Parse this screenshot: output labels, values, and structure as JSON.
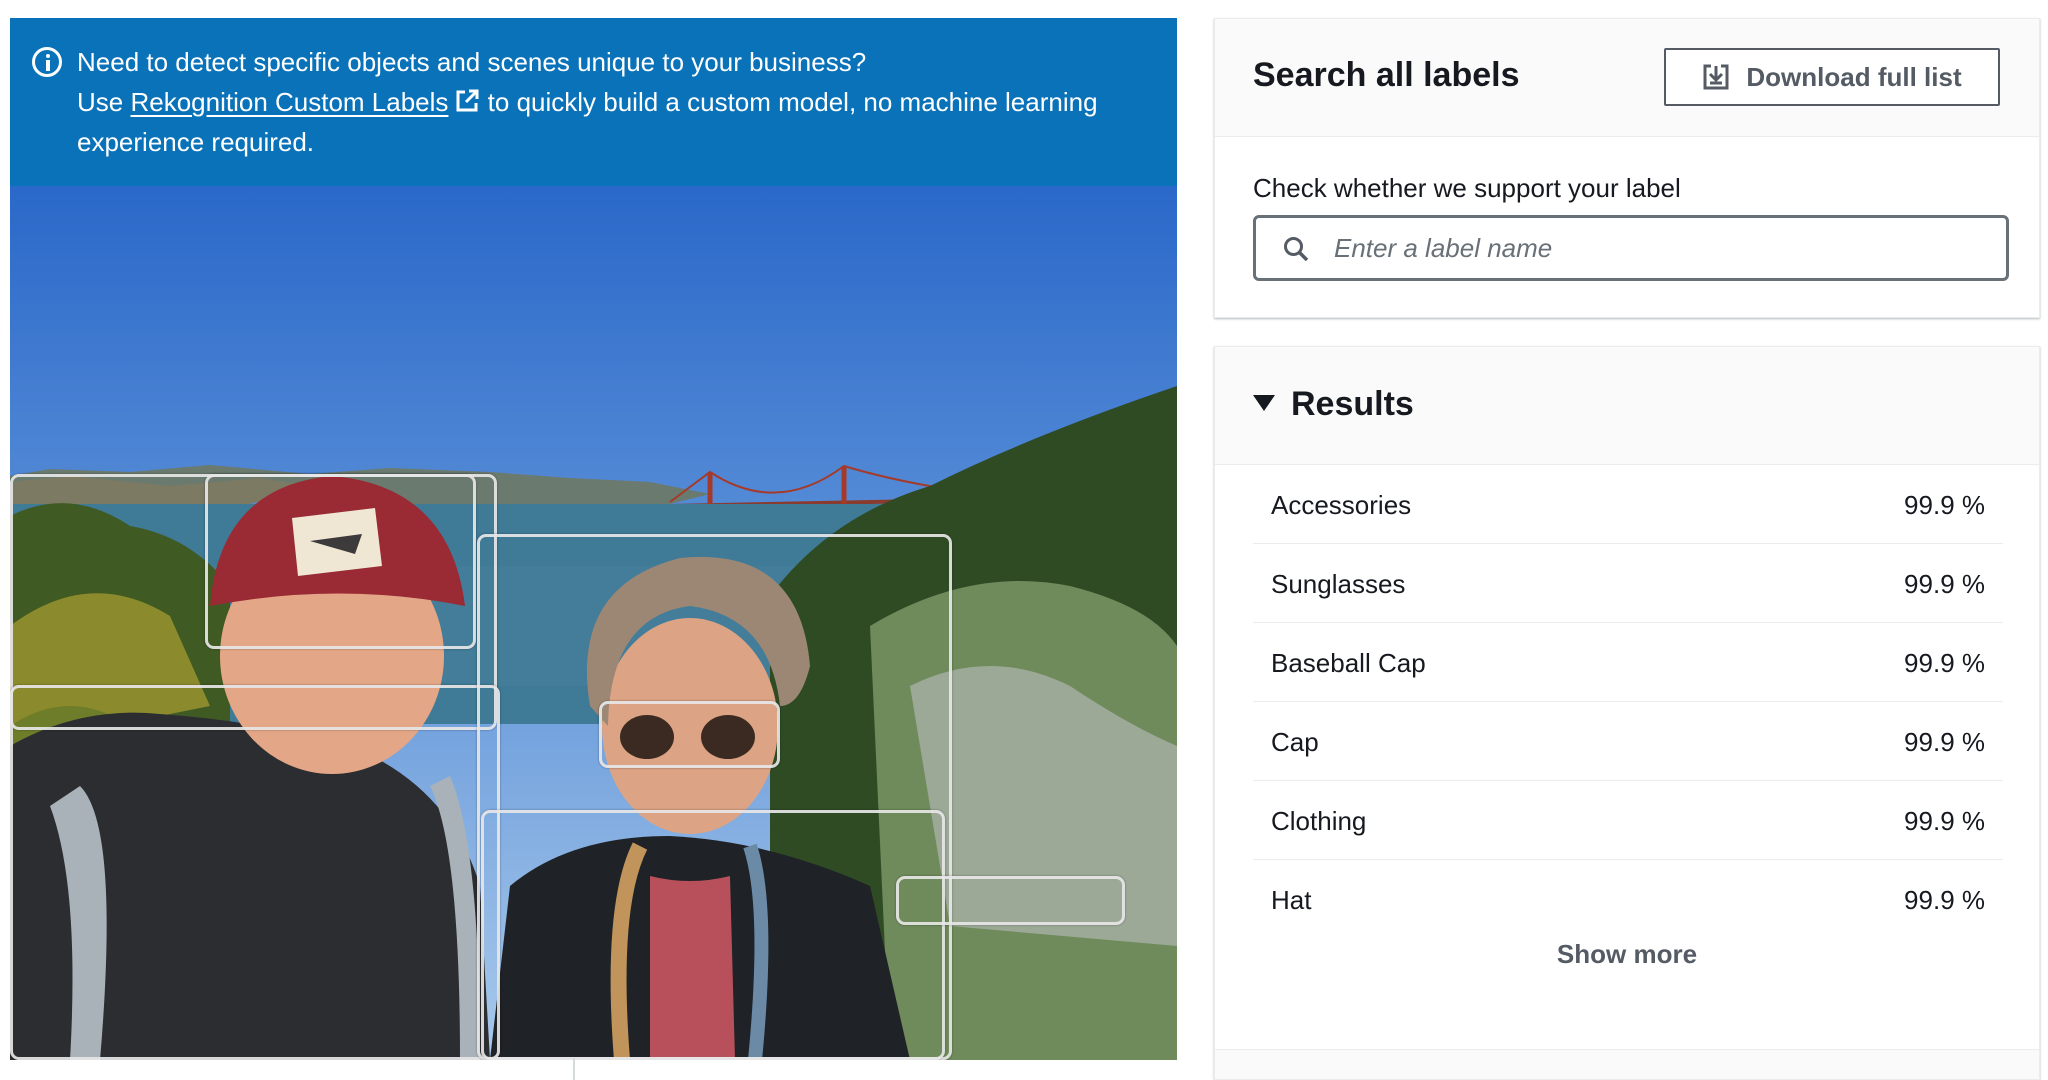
{
  "info_banner": {
    "line1": "Need to detect specific objects and scenes unique to your business?",
    "use_prefix": "Use ",
    "link_text": "Rekognition Custom Labels",
    "suffix": " to quickly build a custom model, no machine learning experience required."
  },
  "search_panel": {
    "title": "Search all labels",
    "download_button": "Download full list",
    "field_label": "Check whether we support your label",
    "search_placeholder": "Enter a label name",
    "search_value": ""
  },
  "results": {
    "title": "Results",
    "expanded": true,
    "items": [
      {
        "label": "Accessories",
        "confidence": "99.9 %"
      },
      {
        "label": "Sunglasses",
        "confidence": "99.9 %"
      },
      {
        "label": "Baseball Cap",
        "confidence": "99.9 %"
      },
      {
        "label": "Cap",
        "confidence": "99.9 %"
      },
      {
        "label": "Clothing",
        "confidence": "99.9 %"
      },
      {
        "label": "Hat",
        "confidence": "99.9 %"
      }
    ],
    "show_more": "Show more"
  },
  "colors": {
    "banner_bg": "#0972b8",
    "text_primary": "#16191f",
    "button_border": "#545b64"
  },
  "icons": [
    "info-icon",
    "external-link-icon",
    "download-icon",
    "search-icon",
    "caret-down-icon"
  ]
}
